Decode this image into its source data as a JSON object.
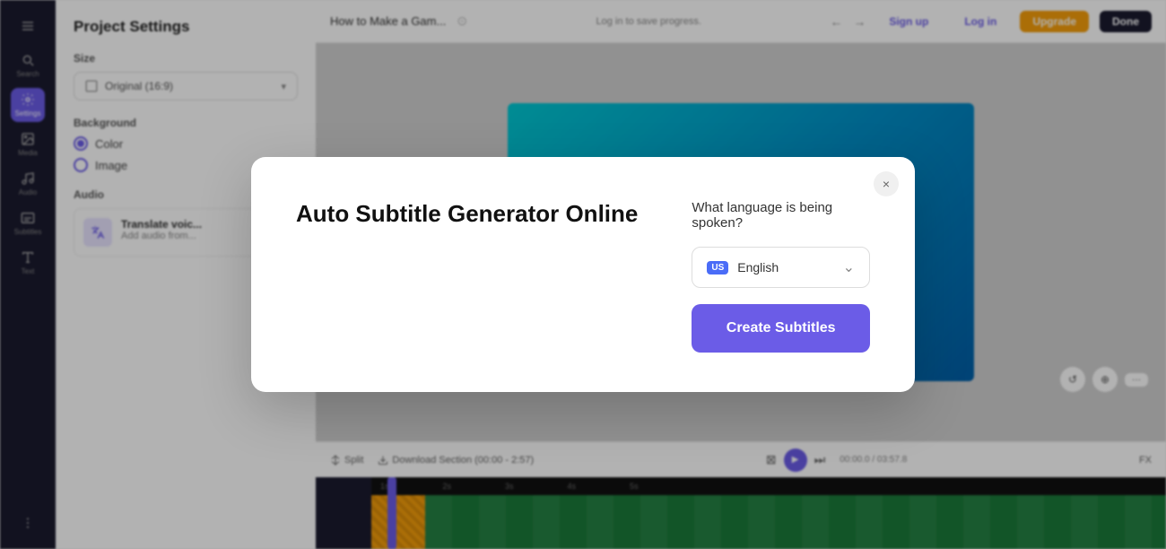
{
  "app": {
    "title": "How to Make a Gam...",
    "save_progress_label": "Log in to save progress.",
    "signup_label": "Sign up",
    "login_label": "Log in",
    "upgrade_label": "Upgrade",
    "done_label": "Done"
  },
  "sidebar": {
    "items": [
      {
        "id": "menu",
        "label": "",
        "icon": "menu",
        "active": false
      },
      {
        "id": "search",
        "label": "Search",
        "icon": "search",
        "active": false
      },
      {
        "id": "settings",
        "label": "Settings",
        "icon": "settings",
        "active": true
      },
      {
        "id": "media",
        "label": "Media",
        "icon": "media",
        "active": false
      },
      {
        "id": "audio",
        "label": "Audio",
        "icon": "audio",
        "active": false
      },
      {
        "id": "subtitles",
        "label": "Subtitles",
        "icon": "subtitles",
        "active": false
      },
      {
        "id": "text",
        "label": "Text",
        "icon": "text",
        "active": false
      },
      {
        "id": "more",
        "label": "",
        "icon": "more",
        "active": false
      }
    ]
  },
  "settings_panel": {
    "title": "Project Settings",
    "size_label": "Size",
    "size_value": "Original (16:9)",
    "background_label": "Background",
    "background_options": [
      "Color",
      "Image"
    ],
    "audio_label": "Audio",
    "translate_title": "Translate voic...",
    "translate_sub": "Add audio from..."
  },
  "bottom_bar": {
    "split_label": "Split",
    "download_label": "Download Section (00:00 - 2:57)",
    "time_current": "00:00.0",
    "time_total": "03:57.8",
    "zoom_label": "FX"
  },
  "modal": {
    "title": "Auto Subtitle Generator Online",
    "close_label": "×",
    "question": "What language is being spoken?",
    "language_badge": "US",
    "language_name": "English",
    "language_full": "US English",
    "create_button_label": "Create Subtitles",
    "chevron": "⌄"
  }
}
